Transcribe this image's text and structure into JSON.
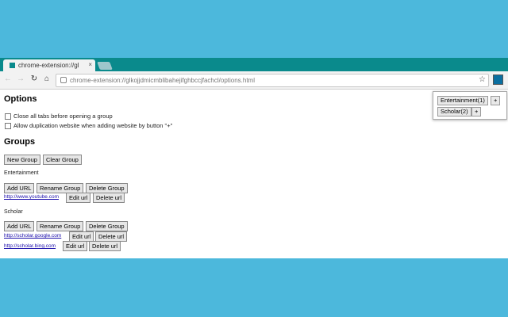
{
  "tab": {
    "title": "chrome-extension://gl",
    "close": "×"
  },
  "nav": {
    "back": "←",
    "forward": "→",
    "reload": "↻",
    "home": "⌂"
  },
  "omnibox": {
    "url": "chrome-extension://glkojjdmicmblibahejifghbccjfachcl/options.html",
    "star": "☆"
  },
  "options": {
    "heading": "Options",
    "close_tabs_label": "Close all tabs before opening a group",
    "allow_dup_label": "Allow duplication website when adding website by button \"+\""
  },
  "groups": {
    "heading": "Groups",
    "new_group": "New Group",
    "clear_group": "Clear Group",
    "items": [
      {
        "name": "Entertainment",
        "add_url": "Add URL",
        "rename": "Rename Group",
        "delete": "Delete Group",
        "urls": [
          {
            "url": "http://www.youtube.com",
            "edit": "Edit url",
            "delete": "Delete url"
          }
        ]
      },
      {
        "name": "Scholar",
        "add_url": "Add URL",
        "rename": "Rename Group",
        "delete": "Delete Group",
        "urls": [
          {
            "url": "http://scholar.google.com",
            "edit": "Edit url",
            "delete": "Delete url"
          },
          {
            "url": "http://scholar.bing.com",
            "edit": "Edit url",
            "delete": "Delete url"
          }
        ]
      }
    ]
  },
  "popup": {
    "entries": [
      {
        "label": "Entertainment(1)",
        "plus": "+"
      },
      {
        "label": "Scholar(2)",
        "plus": "+"
      }
    ]
  }
}
